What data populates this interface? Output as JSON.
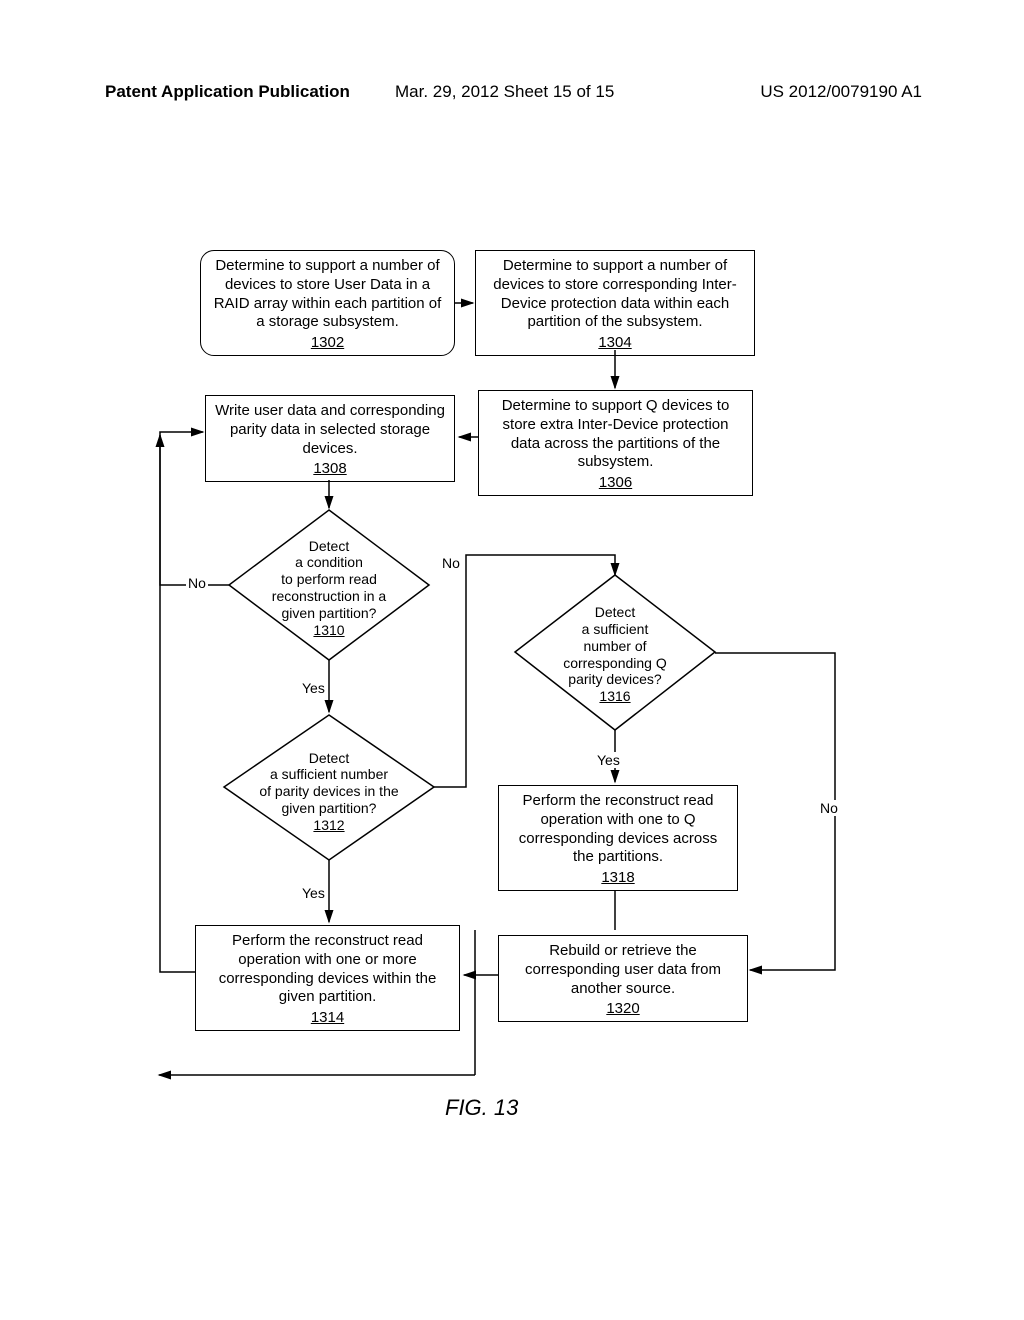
{
  "header": {
    "left": "Patent Application Publication",
    "mid": "Mar. 29, 2012  Sheet 15 of 15",
    "right": "US 2012/0079190 A1"
  },
  "caption": "FIG. 13",
  "labels": {
    "yes": "Yes",
    "no": "No"
  },
  "boxes": {
    "b1302": {
      "text": "Determine to support a number of devices to store User Data in a RAID array within each partition of a storage subsystem.",
      "num": "1302"
    },
    "b1304": {
      "text": "Determine to support a number of devices to store corresponding Inter-Device protection data within each partition of the subsystem.",
      "num": "1304"
    },
    "b1306": {
      "text": "Determine to support Q devices to store extra Inter-Device protection data across the partitions of the subsystem.",
      "num": "1306"
    },
    "b1308": {
      "text": "Write user data and corresponding parity data in selected storage devices.",
      "num": "1308"
    },
    "b1314": {
      "text": "Perform the reconstruct read operation with one or more corresponding devices within the given partition.",
      "num": "1314"
    },
    "b1318": {
      "text": "Perform the reconstruct read operation with one to Q corresponding devices across the partitions.",
      "num": "1318"
    },
    "b1320": {
      "text": "Rebuild or retrieve the corresponding user data from another source.",
      "num": "1320"
    }
  },
  "diamonds": {
    "d1310": {
      "lines": [
        "Detect",
        "a condition",
        "to perform read",
        "reconstruction in a",
        "given partition?"
      ],
      "num": "1310"
    },
    "d1312": {
      "lines": [
        "Detect",
        "a sufficient number",
        "of parity devices in the",
        "given partition?"
      ],
      "num": "1312"
    },
    "d1316": {
      "lines": [
        "Detect",
        "a sufficient",
        "number of",
        "corresponding Q",
        "parity devices?"
      ],
      "num": "1316"
    }
  }
}
